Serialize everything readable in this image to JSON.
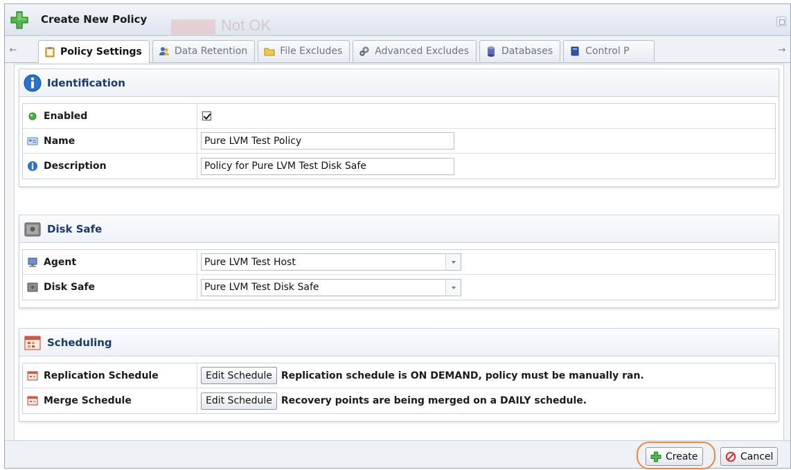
{
  "window": {
    "title": "Create New Policy",
    "background_ghost_text": "Not OK"
  },
  "tabs": [
    {
      "label": "Policy Settings",
      "icon": "clipboard-icon",
      "active": true
    },
    {
      "label": "Data Retention",
      "icon": "users-icon",
      "active": false
    },
    {
      "label": "File Excludes",
      "icon": "folder-icon",
      "active": false
    },
    {
      "label": "Advanced Excludes",
      "icon": "gears-icon",
      "active": false
    },
    {
      "label": "Databases",
      "icon": "database-icon",
      "active": false
    },
    {
      "label": "Control P",
      "icon": "book-icon",
      "active": false
    }
  ],
  "identification": {
    "title": "Identification",
    "enabled_label": "Enabled",
    "enabled_checked": true,
    "name_label": "Name",
    "name_value": "Pure LVM Test Policy",
    "description_label": "Description",
    "description_value": "Policy for Pure LVM Test Disk Safe"
  },
  "disk_safe": {
    "title": "Disk Safe",
    "agent_label": "Agent",
    "agent_value": "Pure LVM Test Host",
    "disk_safe_label": "Disk Safe",
    "disk_safe_value": "Pure LVM Test Disk Safe"
  },
  "scheduling": {
    "title": "Scheduling",
    "replication_label": "Replication Schedule",
    "replication_button": "Edit Schedule",
    "replication_desc": "Replication schedule is ON DEMAND, policy must be manually ran.",
    "merge_label": "Merge Schedule",
    "merge_button": "Edit Schedule",
    "merge_desc": "Recovery points are being merged on a DAILY schedule."
  },
  "footer": {
    "create_label": "Create",
    "cancel_label": "Cancel"
  },
  "colors": {
    "section_title": "#193a6e",
    "highlight_ring": "#e9893a",
    "create_green": "#3aa63a",
    "cancel_red": "#d23030"
  }
}
